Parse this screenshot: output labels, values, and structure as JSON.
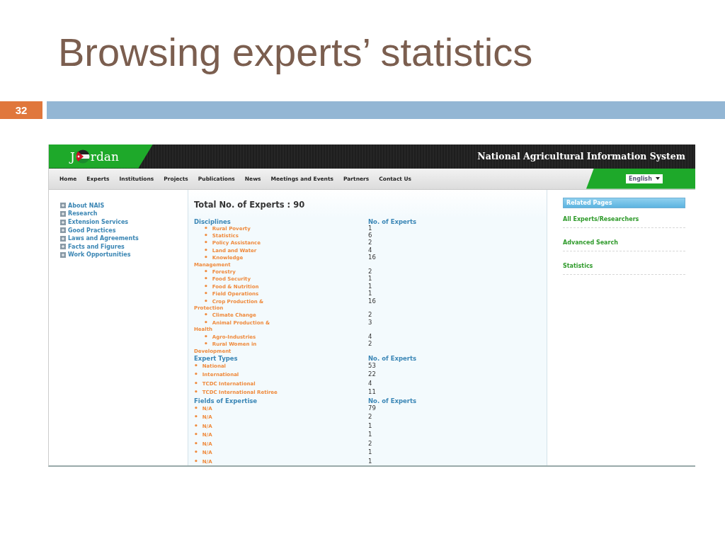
{
  "slide": {
    "title": "Browsing experts’ statistics",
    "number": "32"
  },
  "site": {
    "logo": {
      "before": "J",
      "after": "rdan"
    },
    "title": "National Agricultural Information System",
    "nav": [
      "Home",
      "Experts",
      "Institutions",
      "Projects",
      "Publications",
      "News",
      "Meetings and Events",
      "Partners",
      "Contact Us"
    ],
    "language": "English",
    "sidebar": [
      "About NAIS",
      "Research",
      "Extension Services",
      "Good Practices",
      "Laws and Agreements",
      "Facts and Figures",
      "Work Opportunities"
    ],
    "total": "Total No. of Experts : 90",
    "bullet": "•",
    "sections": [
      {
        "heading": "Disciplines",
        "count_heading": "No. of Experts",
        "indented": true,
        "rows": [
          {
            "name": "Rural Poverty",
            "count": "1"
          },
          {
            "name": "Statistics",
            "count": "6"
          },
          {
            "name": "Policy Assistance",
            "count": "2"
          },
          {
            "name": "Land and Water",
            "count": "4"
          },
          {
            "name": "Knowledge Management",
            "count": "16"
          },
          {
            "name": "Forestry",
            "count": "2"
          },
          {
            "name": "Food Security",
            "count": "1"
          },
          {
            "name": "Food & Nutrition",
            "count": "1"
          },
          {
            "name": "Field Operations",
            "count": "1"
          },
          {
            "name": "Crop Production & Protection",
            "count": "16"
          },
          {
            "name": "Climate Change",
            "count": "2"
          },
          {
            "name": "Animal Production & Health",
            "count": "3"
          },
          {
            "name": "Agro-Industries",
            "count": "4"
          },
          {
            "name": "Rural Women in Development",
            "count": "2"
          }
        ]
      },
      {
        "heading": "Expert Types",
        "count_heading": "No. of Experts",
        "indented": false,
        "rows": [
          {
            "name": "National",
            "count": "53"
          },
          {
            "name": "International",
            "count": "22"
          },
          {
            "name": "TCDC International",
            "count": "4"
          },
          {
            "name": "TCDC International Retiree",
            "count": "11"
          }
        ]
      },
      {
        "heading": "Fields of Expertise",
        "count_heading": "No. of Experts",
        "indented": false,
        "rows": [
          {
            "name": "N/A",
            "count": "79"
          },
          {
            "name": "N/A",
            "count": "2"
          },
          {
            "name": "N/A",
            "count": "1"
          },
          {
            "name": "N/A",
            "count": "1"
          },
          {
            "name": "N/A",
            "count": "2"
          },
          {
            "name": "N/A",
            "count": "1"
          },
          {
            "name": "N/A",
            "count": "1"
          }
        ]
      }
    ],
    "related": {
      "title": "Related Pages",
      "links": [
        "All Experts/Researchers",
        "Advanced Search",
        "Statistics"
      ]
    }
  }
}
